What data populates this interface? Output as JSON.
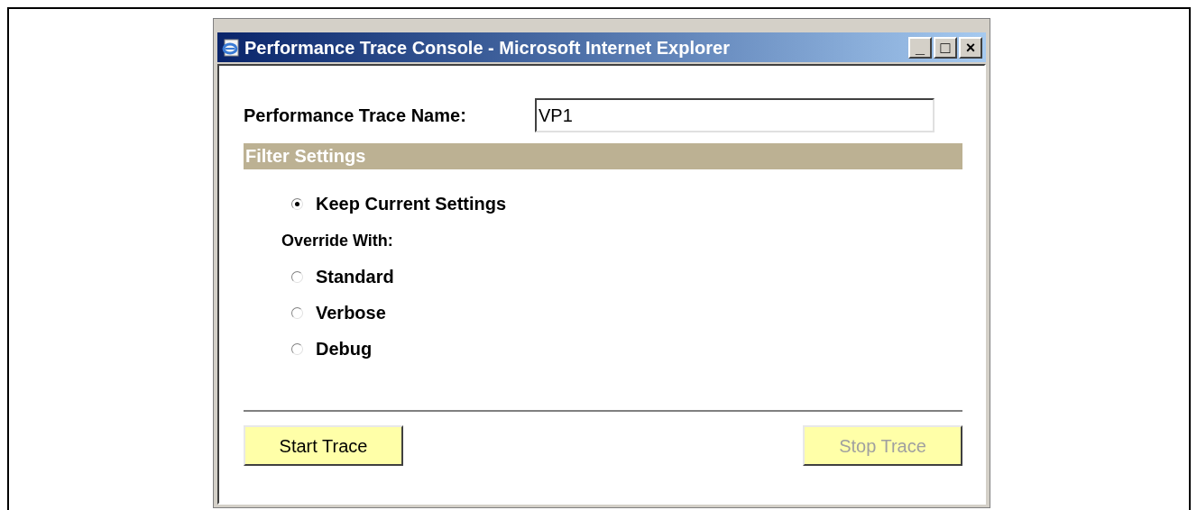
{
  "window": {
    "title": "Performance Trace Console - Microsoft Internet Explorer",
    "controls": [
      "_",
      "□",
      "×"
    ]
  },
  "trace_name": {
    "label": "Performance Trace Name:",
    "value": "VP1"
  },
  "filter_settings": {
    "title": "Filter Settings",
    "keep_option": {
      "label": "Keep Current Settings",
      "selected": true
    },
    "override_label": "Override With:",
    "override_options": [
      {
        "label": "Standard",
        "selected": false
      },
      {
        "label": "Verbose",
        "selected": false
      },
      {
        "label": "Debug",
        "selected": false
      }
    ]
  },
  "buttons": [
    {
      "label": "Start Trace",
      "disabled": false
    },
    {
      "label": "Stop Trace",
      "disabled": true
    }
  ]
}
